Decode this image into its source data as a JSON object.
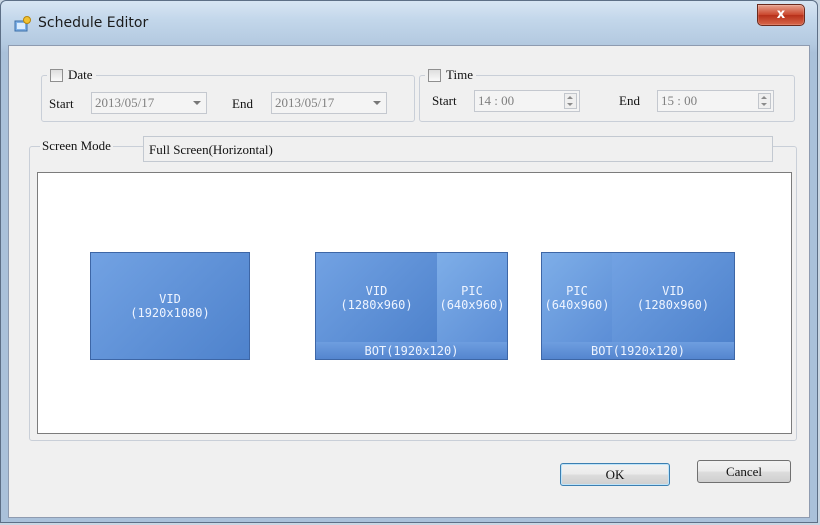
{
  "window": {
    "title": "Schedule Editor",
    "close_glyph": "x"
  },
  "date_group": {
    "legend": "Date",
    "start_label": "Start",
    "start_value": "2013/05/17",
    "end_label": "End",
    "end_value": "2013/05/17"
  },
  "time_group": {
    "legend": "Time",
    "start_label": "Start",
    "start_value": "14 : 00",
    "end_label": "End",
    "end_value": "15 : 00"
  },
  "screen_mode": {
    "label": "Screen Mode",
    "value": "Full Screen(Horizontal)"
  },
  "layouts": [
    {
      "main": {
        "name": "VID",
        "size": "(1920x1080)"
      }
    },
    {
      "left": {
        "name": "VID",
        "size": "(1280x960)"
      },
      "right": {
        "name": "PIC",
        "size": "(640x960)"
      },
      "bottom": "BOT(1920x120)"
    },
    {
      "left": {
        "name": "PIC",
        "size": "(640x960)"
      },
      "right": {
        "name": "VID",
        "size": "(1280x960)"
      },
      "bottom": "BOT(1920x120)"
    }
  ],
  "buttons": {
    "ok": "OK",
    "cancel": "Cancel"
  },
  "icons": {
    "title": "schedule-app-icon",
    "close": "close-icon",
    "dropdown": "chevron-down-icon",
    "spinner": "spinner-icon"
  },
  "colors": {
    "tile_blue": "#5b8ad2",
    "close_red": "#c9452b",
    "default_button_border": "#3c7fb1"
  }
}
